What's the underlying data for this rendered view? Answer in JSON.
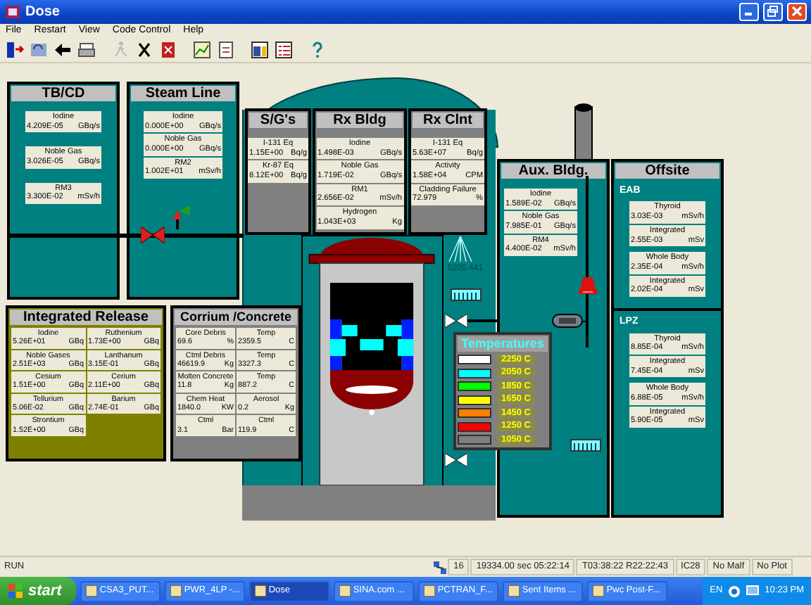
{
  "window": {
    "title": "Dose"
  },
  "menu": [
    "File",
    "Restart",
    "View",
    "Code Control",
    "Help"
  ],
  "tb_cd": {
    "title": "TB/CD",
    "groups": [
      [
        {
          "label": "Iodine",
          "value": "4.209E-05",
          "unit": "GBq/s"
        }
      ],
      [
        {
          "label": "Noble Gas",
          "value": "3.026E-05",
          "unit": "GBq/s"
        }
      ],
      [
        {
          "label": "RM3",
          "value": "3.300E-02",
          "unit": "mSv/h"
        }
      ]
    ]
  },
  "steam_line": {
    "title": "Steam Line",
    "groups": [
      [
        {
          "label": "Iodine",
          "value": "0.000E+00",
          "unit": "GBq/s"
        },
        {
          "label": "Noble Gas",
          "value": "0.000E+00",
          "unit": "GBq/s"
        },
        {
          "label": "RM2",
          "value": "1.002E+01",
          "unit": "mSv/h"
        }
      ]
    ]
  },
  "sgs": {
    "title": "S/G's",
    "groups": [
      [
        {
          "label": "I-131 Eq",
          "value": "1.15E+00",
          "unit": "Bq/g"
        },
        {
          "label": "Kr-87 Eq",
          "value": "8.12E+00",
          "unit": "Bq/g"
        }
      ]
    ]
  },
  "rx_bldg": {
    "title": "Rx Bldg",
    "groups": [
      [
        {
          "label": "Iodine",
          "value": "1.498E-03",
          "unit": "GBq/s"
        },
        {
          "label": "Noble Gas",
          "value": "1.719E-02",
          "unit": "GBq/s"
        },
        {
          "label": "RM1",
          "value": "2.656E-02",
          "unit": "mSv/h"
        },
        {
          "label": "Hydrogen",
          "value": "1.043E+03",
          "unit": "Kg"
        }
      ]
    ]
  },
  "rx_clnt": {
    "title": "Rx Clnt",
    "groups": [
      [
        {
          "label": "I-131 Eq",
          "value": "5.63E+07",
          "unit": "Bq/g"
        },
        {
          "label": "Activity",
          "value": "1.58E+04",
          "unit": "CPM"
        },
        {
          "label": "Cladding Failure",
          "value": "72.979",
          "unit": "%"
        }
      ]
    ]
  },
  "spray": {
    "reading": "5205.441"
  },
  "aux_bldg": {
    "title": "Aux. Bldg.",
    "groups": [
      [
        {
          "label": "Iodine",
          "value": "1.589E-02",
          "unit": "GBq/s"
        },
        {
          "label": "Noble Gas",
          "value": "7.985E-01",
          "unit": "GBq/s"
        },
        {
          "label": "RM4",
          "value": "4.400E-02",
          "unit": "mSv/h"
        }
      ]
    ]
  },
  "offsite": {
    "title": "Offsite",
    "sections": [
      {
        "label": "EAB",
        "groups": [
          [
            {
              "label": "Thyroid",
              "value": "3.03E-03",
              "unit": "mSv/h"
            },
            {
              "label": "Integrated",
              "value": "2.55E-03",
              "unit": "mSv"
            }
          ],
          [
            {
              "label": "Whole Body",
              "value": "2.35E-04",
              "unit": "mSv/h"
            },
            {
              "label": "Integrated",
              "value": "2.02E-04",
              "unit": "mSv"
            }
          ]
        ]
      },
      {
        "label": "LPZ",
        "groups": [
          [
            {
              "label": "Thyroid",
              "value": "8.85E-04",
              "unit": "mSv/h"
            },
            {
              "label": "Integrated",
              "value": "7.45E-04",
              "unit": "mSv"
            }
          ],
          [
            {
              "label": "Whole Body",
              "value": "6.88E-05",
              "unit": "mSv/h"
            },
            {
              "label": "Integrated",
              "value": "5.90E-05",
              "unit": "mSv"
            }
          ]
        ]
      }
    ]
  },
  "integrated_release": {
    "title": "Integrated Release",
    "items": [
      {
        "label": "Iodine",
        "value": "5.26E+01",
        "unit": "GBq"
      },
      {
        "label": "Ruthenium",
        "value": "1.73E+00",
        "unit": "GBq"
      },
      {
        "label": "Noble Gases",
        "value": "2.51E+03",
        "unit": "GBq"
      },
      {
        "label": "Lanthanum",
        "value": "3.15E-01",
        "unit": "GBq"
      },
      {
        "label": "Cesium",
        "value": "1.51E+00",
        "unit": "GBq"
      },
      {
        "label": "Cerium",
        "value": "2.11E+00",
        "unit": "GBq"
      },
      {
        "label": "Tellurium",
        "value": "5.06E-02",
        "unit": "GBq"
      },
      {
        "label": "Barium",
        "value": "2.74E-01",
        "unit": "GBq"
      },
      {
        "label": "Strontium",
        "value": "1.52E+00",
        "unit": "GBq"
      }
    ]
  },
  "corrium_concrete": {
    "title": "Corrium /Concrete",
    "items": [
      {
        "label": "Core Debris",
        "value": "69.6",
        "unit": "%"
      },
      {
        "label": "Temp",
        "value": "2359.5",
        "unit": "C"
      },
      {
        "label": "Ctml Debris",
        "value": "46619.9",
        "unit": "Kg"
      },
      {
        "label": "Temp",
        "value": "3327.3",
        "unit": "C"
      },
      {
        "label": "Molten Concrete",
        "value": "11.8",
        "unit": "Kg"
      },
      {
        "label": "Temp",
        "value": "887.2",
        "unit": "C"
      },
      {
        "label": "Chem Heat",
        "value": "1840.0",
        "unit": "KW"
      },
      {
        "label": "Aerosol",
        "value": "0.2",
        "unit": "Kg"
      },
      {
        "label": "Ctml",
        "value": "3.1",
        "unit": "Bar"
      },
      {
        "label": "Ctml",
        "value": "119.9",
        "unit": "C"
      }
    ]
  },
  "temperatures": {
    "title": "Temperatures",
    "levels": [
      {
        "label": "2250 C",
        "color": "#ffffff"
      },
      {
        "label": "2050 C",
        "color": "#00ffff"
      },
      {
        "label": "1850 C",
        "color": "#00ff00"
      },
      {
        "label": "1650 C",
        "color": "#ffff00"
      },
      {
        "label": "1450 C",
        "color": "#ff8000"
      },
      {
        "label": "1250 C",
        "color": "#ff0000"
      },
      {
        "label": "1050 C",
        "color": "#808080"
      }
    ]
  },
  "status_bar": {
    "mode": "RUN",
    "fields": [
      "16",
      "19334.00 sec  05:22:14",
      "T03:38:22 R22:22:43",
      "IC28",
      "No Malf",
      "No Plot"
    ]
  },
  "taskbar": {
    "start": "start",
    "tasks": [
      {
        "label": "CSA3_PUT...",
        "selected": false
      },
      {
        "label": "PWR_4LP -...",
        "selected": false
      },
      {
        "label": "Dose",
        "selected": true
      },
      {
        "label": "SINA.com ...",
        "selected": false
      },
      {
        "label": "PCTRAN_F...",
        "selected": false
      },
      {
        "label": "Sent Items ...",
        "selected": false
      },
      {
        "label": "Pwc Post-F...",
        "selected": false
      }
    ],
    "language": "EN",
    "clock": "10:23 PM"
  }
}
